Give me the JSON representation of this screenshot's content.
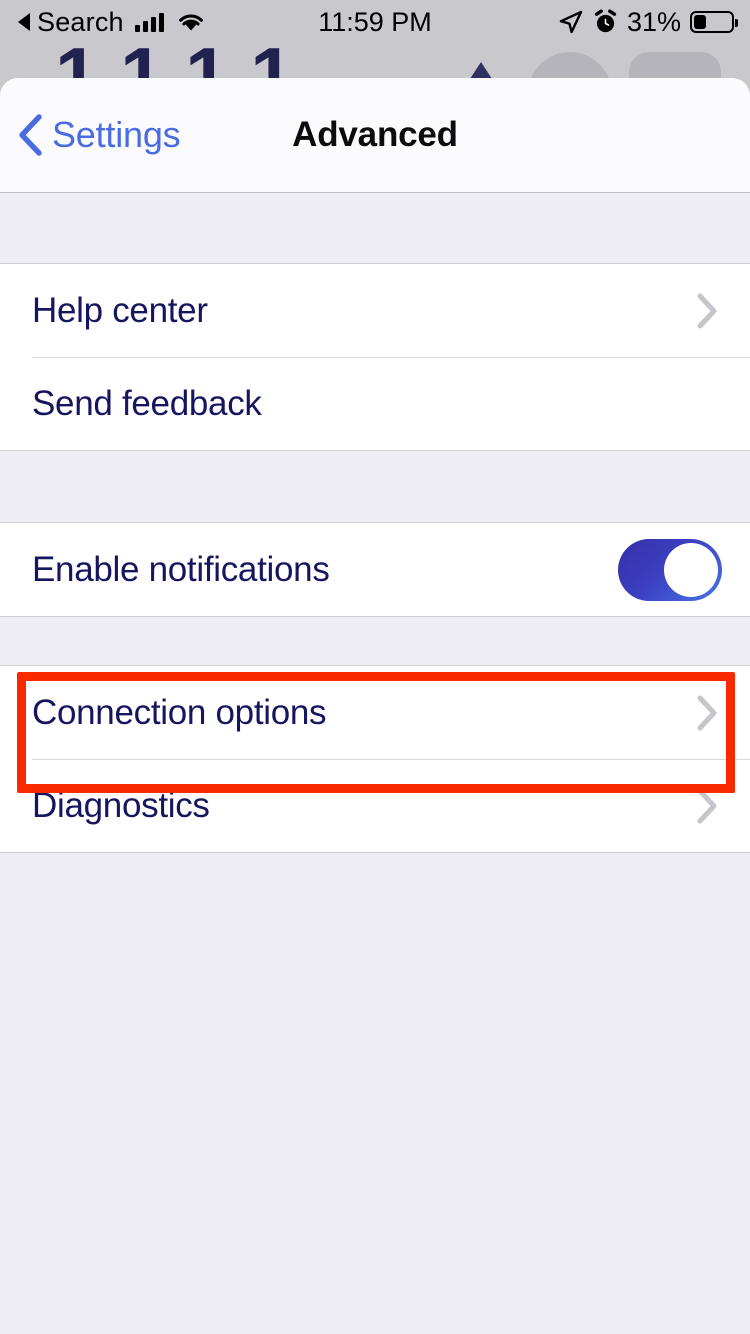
{
  "status_bar": {
    "back_label": "Search",
    "back_icon": "triangle-left-icon",
    "signal_icon": "cellular-bars-icon",
    "wifi_icon": "wifi-icon",
    "time": "11:59 PM",
    "location_icon": "location-arrow-icon",
    "alarm_icon": "alarm-clock-icon",
    "battery_percent": "31%",
    "battery_icon": "battery-icon"
  },
  "background": {
    "digits": "1111",
    "caret_icon": "triangle-up-icon",
    "circle_shape": "circle-placeholder",
    "pill_shape": "rounded-rect-placeholder"
  },
  "nav_bar": {
    "back_icon": "chevron-left-icon",
    "back_label": "Settings",
    "title": "Advanced"
  },
  "sections": [
    {
      "rows": [
        {
          "label": "Help center",
          "accessory": "chevron",
          "chevron_icon": "chevron-right-icon"
        },
        {
          "label": "Send feedback",
          "accessory": "none"
        }
      ]
    },
    {
      "rows": [
        {
          "label": "Enable notifications",
          "accessory": "toggle",
          "toggle_on": true
        }
      ]
    },
    {
      "rows": [
        {
          "label": "Connection options",
          "accessory": "chevron",
          "chevron_icon": "chevron-right-icon",
          "highlighted": true
        },
        {
          "label": "Diagnostics",
          "accessory": "chevron",
          "chevron_icon": "chevron-right-icon"
        }
      ]
    }
  ],
  "colors": {
    "accent_blue": "#4a6ce0",
    "label_navy": "#151560",
    "toggle_on_start": "#3730a8",
    "toggle_on_end": "#4a74e8",
    "highlight_red": "#fa2a00",
    "group_background": "#eeedf3",
    "row_background": "#ffffff",
    "backdrop": "#c9c9cd",
    "chevron_grey": "#c5c5cb"
  }
}
